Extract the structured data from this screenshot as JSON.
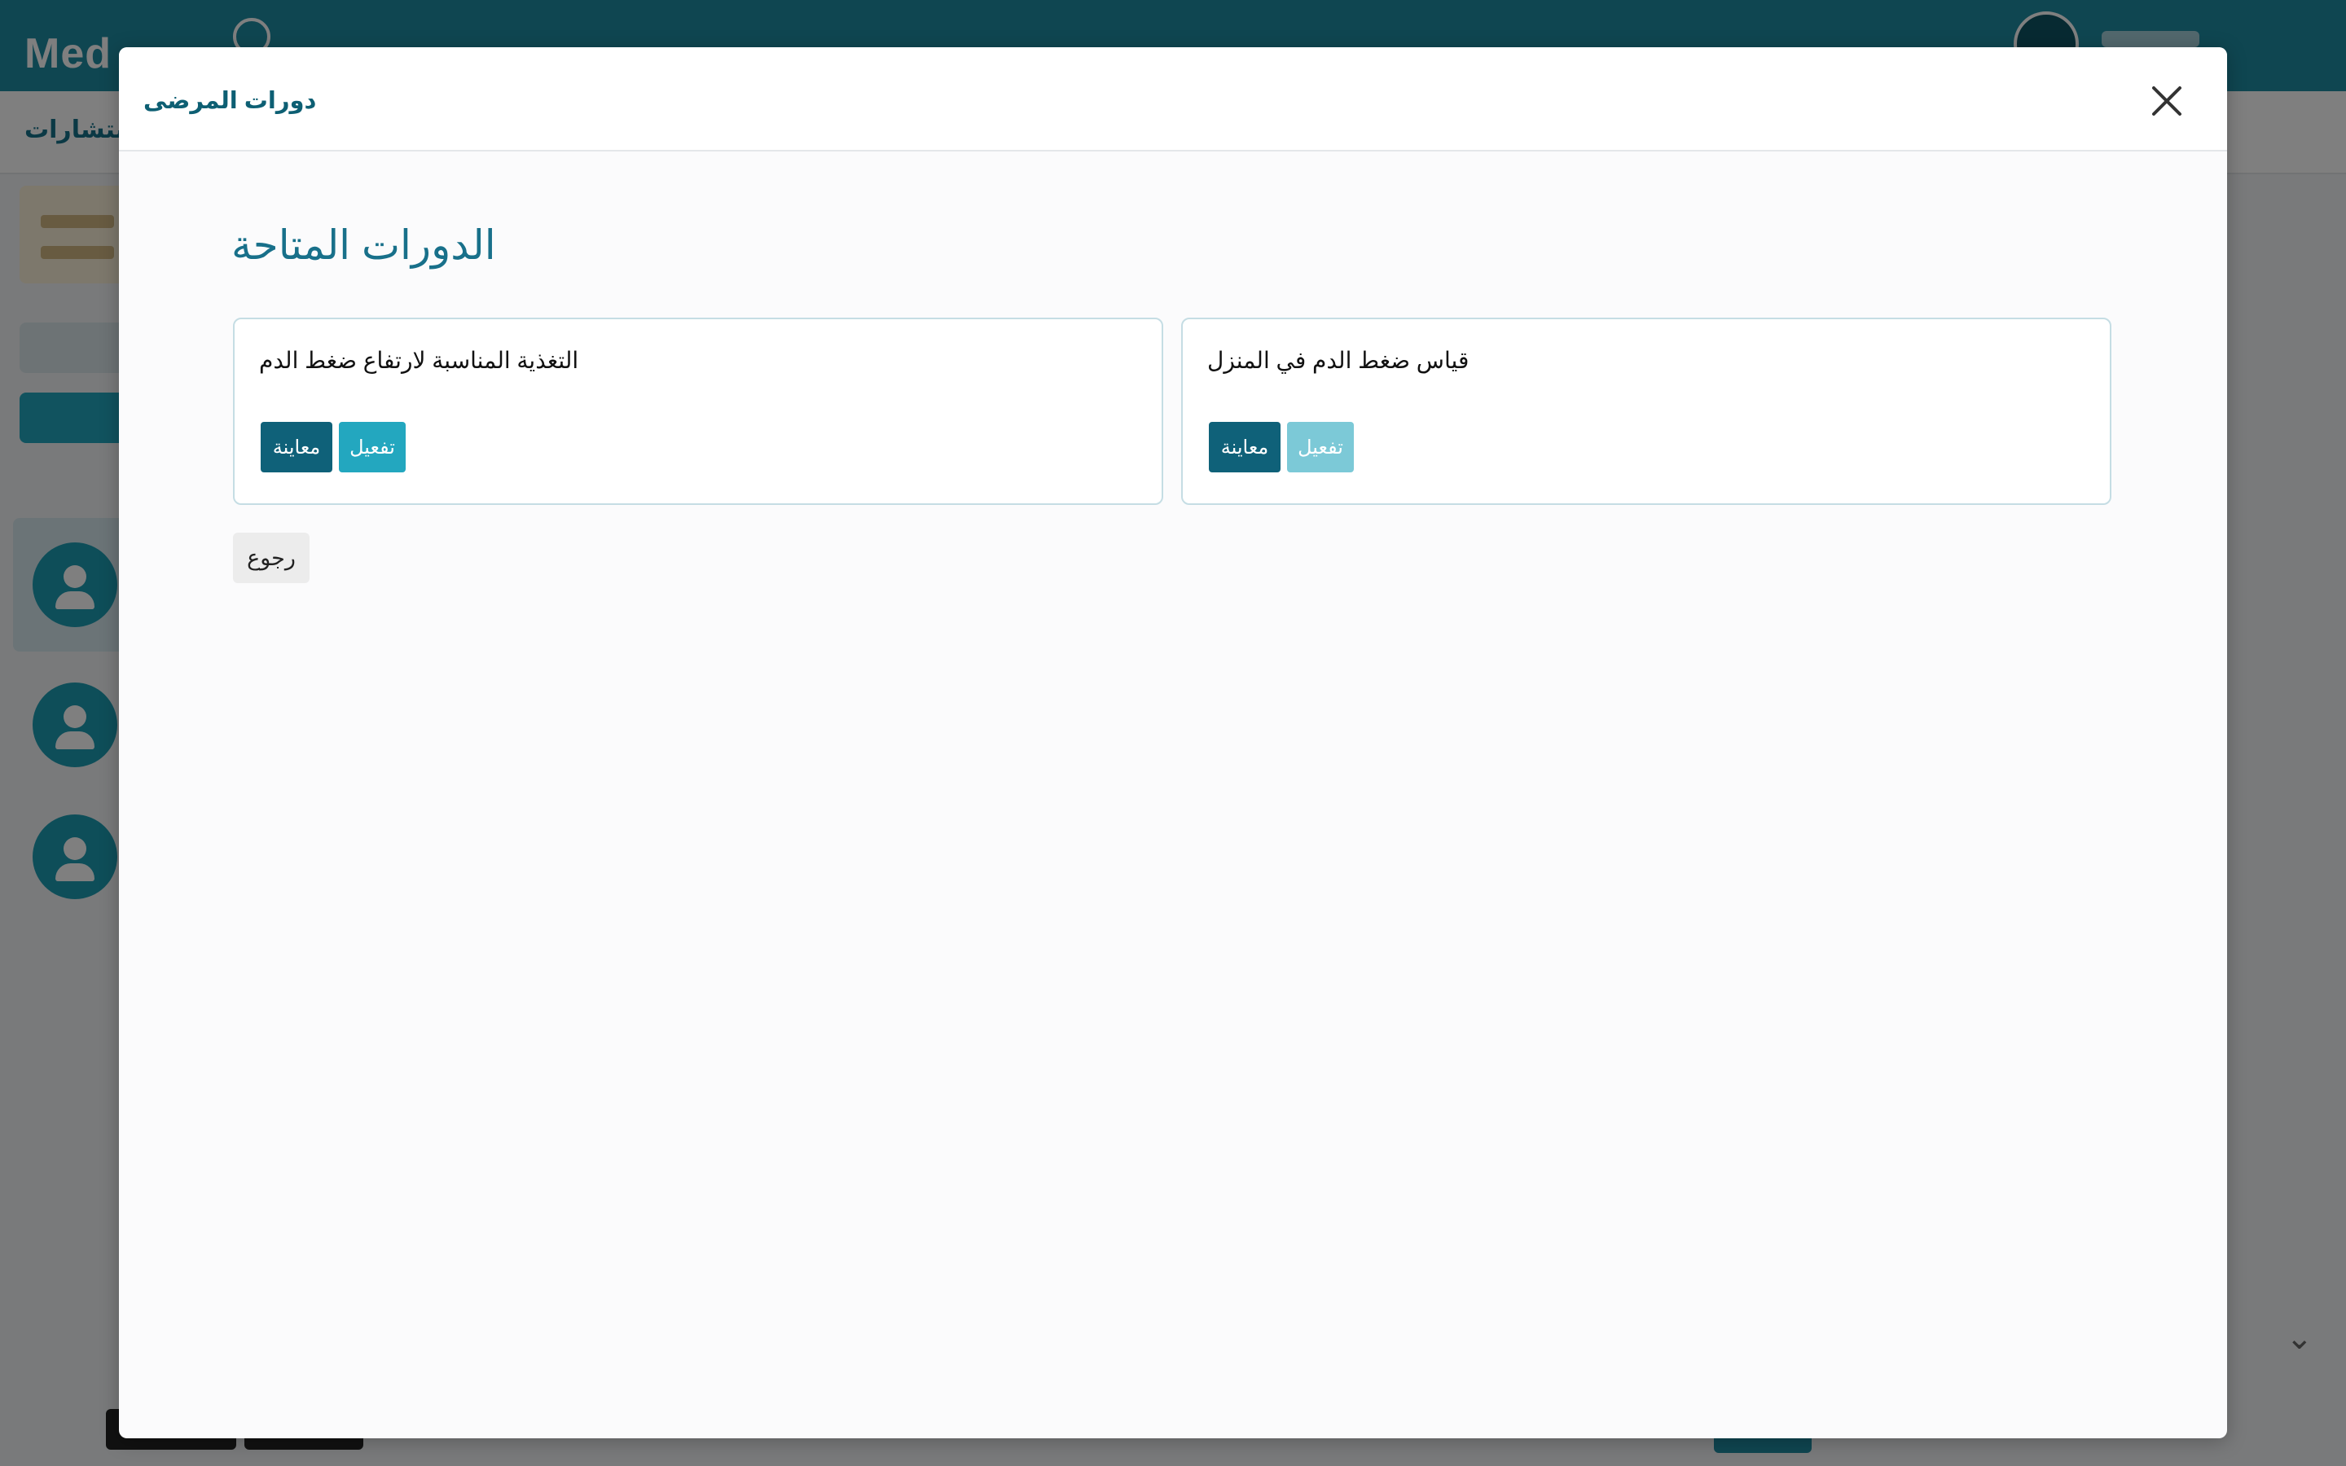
{
  "background": {
    "logo_text": "Med",
    "subnav_text": "ستشارات"
  },
  "modal": {
    "title": "دورات المرضى",
    "close_icon": "close-icon",
    "heading": "الدورات المتاحة",
    "courses": [
      {
        "title": "التغذية المناسبة لارتفاع ضغط الدم",
        "preview_label": "معاينة",
        "activate_label": "تفعيل",
        "activate_disabled": false
      },
      {
        "title": "قياس ضغط الدم في المنزل",
        "preview_label": "معاينة",
        "activate_label": "تفعيل",
        "activate_disabled": true
      }
    ],
    "back_label": "رجوع"
  },
  "colors": {
    "primary": "#0f6179",
    "accent": "#23a7bf",
    "accent_disabled": "#7cc9d7",
    "topbar": "#1f8ca3"
  }
}
